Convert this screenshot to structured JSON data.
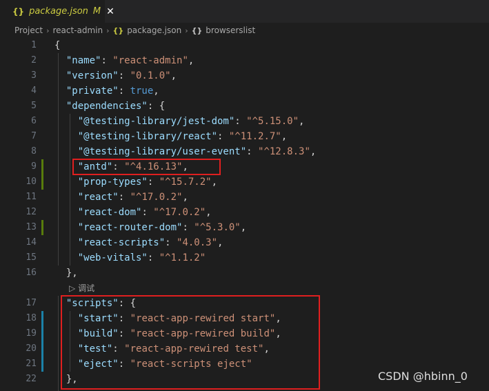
{
  "tab": {
    "icon": "{}",
    "name": "package.json",
    "modified": "M",
    "close": "✕"
  },
  "breadcrumb": [
    {
      "label": "Project",
      "icon": ""
    },
    {
      "label": "react-admin",
      "icon": ""
    },
    {
      "label": "package.json",
      "icon": "{}"
    },
    {
      "label": "browserslist",
      "icon": "{}"
    }
  ],
  "code_lens": "调试",
  "watermark": "CSDN @hbinn_0",
  "colors": {
    "key": "#9cdcfe",
    "string": "#ce9178",
    "keyword": "#569cd6",
    "highlight_box": "#e01f1f",
    "tab_text": "#cbcb41"
  },
  "lines": [
    {
      "n": "1",
      "tokens": [
        {
          "t": "p",
          "v": "{"
        }
      ]
    },
    {
      "n": "2",
      "tokens": [
        {
          "t": "p",
          "v": "  "
        },
        {
          "t": "k",
          "v": "\"name\""
        },
        {
          "t": "p",
          "v": ": "
        },
        {
          "t": "s",
          "v": "\"react-admin\""
        },
        {
          "t": "p",
          "v": ","
        }
      ]
    },
    {
      "n": "3",
      "tokens": [
        {
          "t": "p",
          "v": "  "
        },
        {
          "t": "k",
          "v": "\"version\""
        },
        {
          "t": "p",
          "v": ": "
        },
        {
          "t": "s",
          "v": "\"0.1.0\""
        },
        {
          "t": "p",
          "v": ","
        }
      ]
    },
    {
      "n": "4",
      "tokens": [
        {
          "t": "p",
          "v": "  "
        },
        {
          "t": "k",
          "v": "\"private\""
        },
        {
          "t": "p",
          "v": ": "
        },
        {
          "t": "w",
          "v": "true"
        },
        {
          "t": "p",
          "v": ","
        }
      ]
    },
    {
      "n": "5",
      "tokens": [
        {
          "t": "p",
          "v": "  "
        },
        {
          "t": "k",
          "v": "\"dependencies\""
        },
        {
          "t": "p",
          "v": ": {"
        }
      ]
    },
    {
      "n": "6",
      "tokens": [
        {
          "t": "p",
          "v": "    "
        },
        {
          "t": "k",
          "v": "\"@testing-library/jest-dom\""
        },
        {
          "t": "p",
          "v": ": "
        },
        {
          "t": "s",
          "v": "\"^5.15.0\""
        },
        {
          "t": "p",
          "v": ","
        }
      ]
    },
    {
      "n": "7",
      "tokens": [
        {
          "t": "p",
          "v": "    "
        },
        {
          "t": "k",
          "v": "\"@testing-library/react\""
        },
        {
          "t": "p",
          "v": ": "
        },
        {
          "t": "s",
          "v": "\"^11.2.7\""
        },
        {
          "t": "p",
          "v": ","
        }
      ]
    },
    {
      "n": "8",
      "tokens": [
        {
          "t": "p",
          "v": "    "
        },
        {
          "t": "k",
          "v": "\"@testing-library/user-event\""
        },
        {
          "t": "p",
          "v": ": "
        },
        {
          "t": "s",
          "v": "\"^12.8.3\""
        },
        {
          "t": "p",
          "v": ","
        }
      ]
    },
    {
      "n": "9",
      "tokens": [
        {
          "t": "p",
          "v": "    "
        },
        {
          "t": "k",
          "v": "\"antd\""
        },
        {
          "t": "p",
          "v": ": "
        },
        {
          "t": "s",
          "v": "\"^4.16.13\""
        },
        {
          "t": "p",
          "v": ","
        }
      ]
    },
    {
      "n": "10",
      "tokens": [
        {
          "t": "p",
          "v": "    "
        },
        {
          "t": "k",
          "v": "\"prop-types\""
        },
        {
          "t": "p",
          "v": ": "
        },
        {
          "t": "s",
          "v": "\"^15.7.2\""
        },
        {
          "t": "p",
          "v": ","
        }
      ]
    },
    {
      "n": "11",
      "tokens": [
        {
          "t": "p",
          "v": "    "
        },
        {
          "t": "k",
          "v": "\"react\""
        },
        {
          "t": "p",
          "v": ": "
        },
        {
          "t": "s",
          "v": "\"^17.0.2\""
        },
        {
          "t": "p",
          "v": ","
        }
      ]
    },
    {
      "n": "12",
      "tokens": [
        {
          "t": "p",
          "v": "    "
        },
        {
          "t": "k",
          "v": "\"react-dom\""
        },
        {
          "t": "p",
          "v": ": "
        },
        {
          "t": "s",
          "v": "\"^17.0.2\""
        },
        {
          "t": "p",
          "v": ","
        }
      ]
    },
    {
      "n": "13",
      "tokens": [
        {
          "t": "p",
          "v": "    "
        },
        {
          "t": "k",
          "v": "\"react-router-dom\""
        },
        {
          "t": "p",
          "v": ": "
        },
        {
          "t": "s",
          "v": "\"^5.3.0\""
        },
        {
          "t": "p",
          "v": ","
        }
      ]
    },
    {
      "n": "14",
      "tokens": [
        {
          "t": "p",
          "v": "    "
        },
        {
          "t": "k",
          "v": "\"react-scripts\""
        },
        {
          "t": "p",
          "v": ": "
        },
        {
          "t": "s",
          "v": "\"4.0.3\""
        },
        {
          "t": "p",
          "v": ","
        }
      ]
    },
    {
      "n": "15",
      "tokens": [
        {
          "t": "p",
          "v": "    "
        },
        {
          "t": "k",
          "v": "\"web-vitals\""
        },
        {
          "t": "p",
          "v": ": "
        },
        {
          "t": "s",
          "v": "\"^1.1.2\""
        }
      ]
    },
    {
      "n": "16",
      "tokens": [
        {
          "t": "p",
          "v": "  },"
        }
      ]
    },
    {
      "n": "17",
      "tokens": [
        {
          "t": "p",
          "v": "  "
        },
        {
          "t": "k",
          "v": "\"scripts\""
        },
        {
          "t": "p",
          "v": ": {"
        }
      ]
    },
    {
      "n": "18",
      "tokens": [
        {
          "t": "p",
          "v": "    "
        },
        {
          "t": "k",
          "v": "\"start\""
        },
        {
          "t": "p",
          "v": ": "
        },
        {
          "t": "s",
          "v": "\"react-app-rewired start\""
        },
        {
          "t": "p",
          "v": ","
        }
      ]
    },
    {
      "n": "19",
      "tokens": [
        {
          "t": "p",
          "v": "    "
        },
        {
          "t": "k",
          "v": "\"build\""
        },
        {
          "t": "p",
          "v": ": "
        },
        {
          "t": "s",
          "v": "\"react-app-rewired build\""
        },
        {
          "t": "p",
          "v": ","
        }
      ]
    },
    {
      "n": "20",
      "tokens": [
        {
          "t": "p",
          "v": "    "
        },
        {
          "t": "k",
          "v": "\"test\""
        },
        {
          "t": "p",
          "v": ": "
        },
        {
          "t": "s",
          "v": "\"react-app-rewired test\""
        },
        {
          "t": "p",
          "v": ","
        }
      ]
    },
    {
      "n": "21",
      "tokens": [
        {
          "t": "p",
          "v": "    "
        },
        {
          "t": "k",
          "v": "\"eject\""
        },
        {
          "t": "p",
          "v": ": "
        },
        {
          "t": "s",
          "v": "\"react-scripts eject\""
        }
      ]
    },
    {
      "n": "22",
      "tokens": [
        {
          "t": "p",
          "v": "  },"
        }
      ]
    }
  ]
}
